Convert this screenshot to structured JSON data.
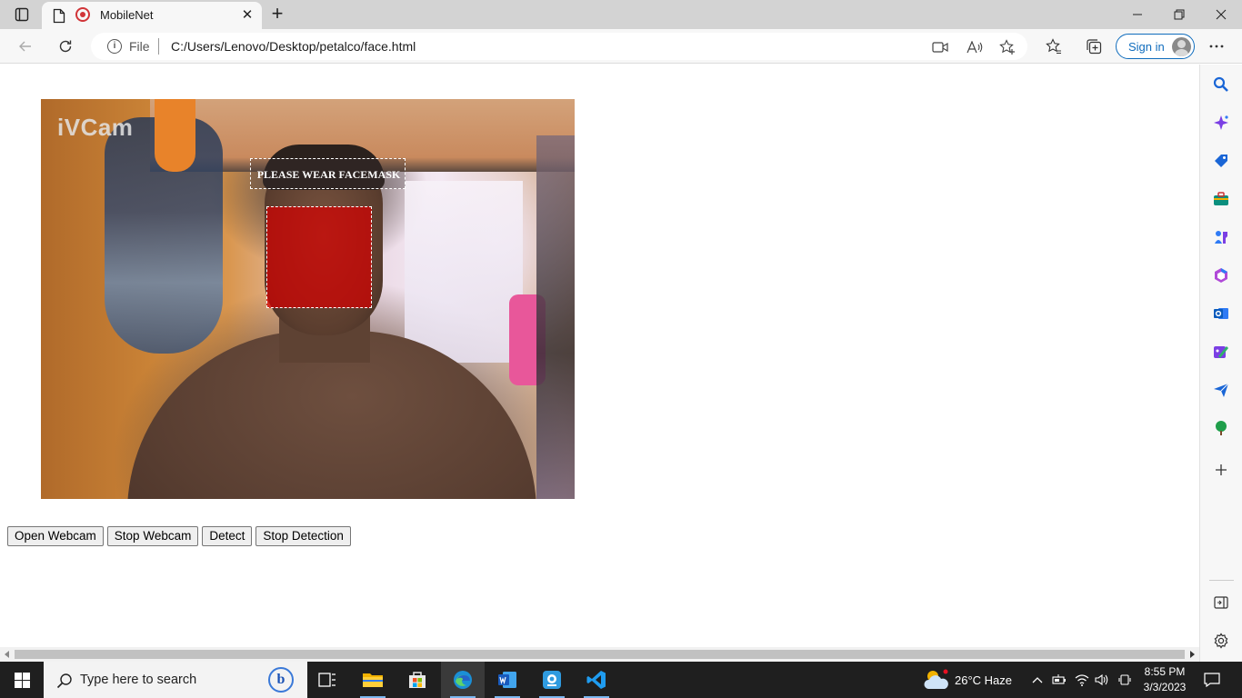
{
  "browser": {
    "tab": {
      "title": "MobileNet"
    },
    "address": {
      "scheme": "File",
      "url": "C:/Users/Lenovo/Desktop/petalco/face.html"
    },
    "signin_label": "Sign in"
  },
  "page": {
    "webcam_logo": "iVCam",
    "detection_label": "PLEASE WEAR FACEMASK",
    "buttons": {
      "open_webcam": "Open Webcam",
      "stop_webcam": "Stop Webcam",
      "detect": "Detect",
      "stop_detection": "Stop Detection"
    }
  },
  "taskbar": {
    "search_placeholder": "Type here to search",
    "weather": "26°C  Haze",
    "time": "8:55 PM",
    "date": "3/3/2023"
  },
  "colors": {
    "detection_box": "#d20000",
    "accent": "#0f6cbd"
  }
}
